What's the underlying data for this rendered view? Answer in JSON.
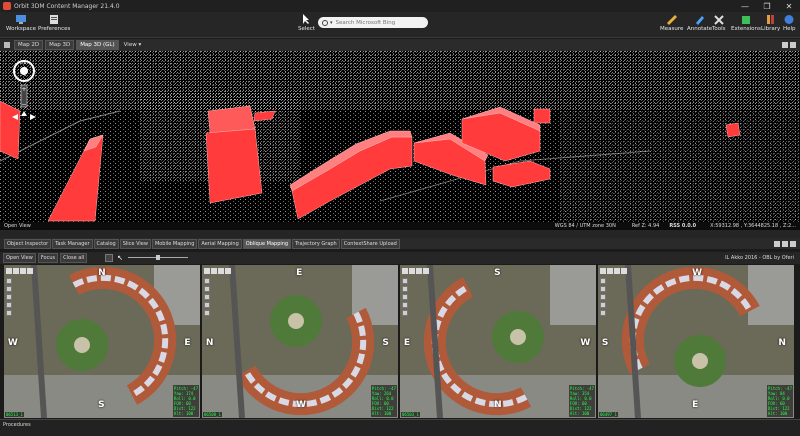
{
  "window": {
    "title": "Orbit 3DM Content Manager 21.4.0",
    "controls": [
      "—",
      "❐",
      "✕"
    ]
  },
  "ribbon": {
    "workspace": "Workspace",
    "preferences": "Preferences",
    "select": "Select",
    "search_placeholder": "Search Microsoft Bing",
    "measure": "Measure",
    "annotate": "Annotate",
    "tools": "Tools",
    "extensions": "Extensions",
    "library": "Library",
    "help": "Help"
  },
  "view_tabs": [
    "Map 2D",
    "Map 3D",
    "Map 3D (GL)"
  ],
  "view_menu": "View",
  "viewport": {
    "open_view": "Open View",
    "status_right": "WGS 84 / UTM zone 30N",
    "ref": "Ref Z: 4.94",
    "rss": "RSS 0.0.0",
    "coords": "X:59312.98 , Y:3644825.18 , Z:2..."
  },
  "bottom_tabs": [
    "Object Inspector",
    "Task Manager",
    "Catalog",
    "Slice View",
    "Mobile Mapping",
    "Aerial Mapping",
    "Oblique Mapping",
    "Trajectory Graph",
    "ContextShare Upload"
  ],
  "active_bottom_tab": 6,
  "oblique_toolbar": {
    "open_view": "Open View",
    "focus": "Focus",
    "close_all": "Close all"
  },
  "credit": "IL Akko 2016 - OBL by Oferi",
  "panels": [
    {
      "compass": [
        "N",
        "W",
        "E",
        "S"
      ],
      "hud": [
        "Pitch:  -47",
        "Yaw:    174",
        "Roll:   0.0",
        "FOV:    60",
        "Dist:   122",
        "Alt:    100"
      ],
      "num": "06513_1"
    },
    {
      "compass": [
        "E",
        "N",
        "S",
        "W"
      ],
      "hud": [
        "Pitch:  -47",
        "Yaw:    264",
        "Roll:   0.0",
        "FOV:    60",
        "Dist:   122",
        "Alt:    100"
      ],
      "num": "06508_1"
    },
    {
      "compass": [
        "S",
        "E",
        "W",
        "N"
      ],
      "hud": [
        "Pitch:  -47",
        "Yaw:    354",
        "Roll:   0.0",
        "FOV:    60",
        "Dist:   122",
        "Alt:    100"
      ],
      "num": "06503_1"
    },
    {
      "compass": [
        "W",
        "S",
        "N",
        "E"
      ],
      "hud": [
        "Pitch:  -47",
        "Yaw:     84",
        "Roll:   0.0",
        "FOV:    60",
        "Dist:   122",
        "Alt:    100"
      ],
      "num": "06497_1"
    }
  ],
  "procedures": "Procedures",
  "colors": {
    "building_red": "#ff3b3b",
    "hud_green": "#26ff4a",
    "ribbon_bg": "#262626"
  }
}
